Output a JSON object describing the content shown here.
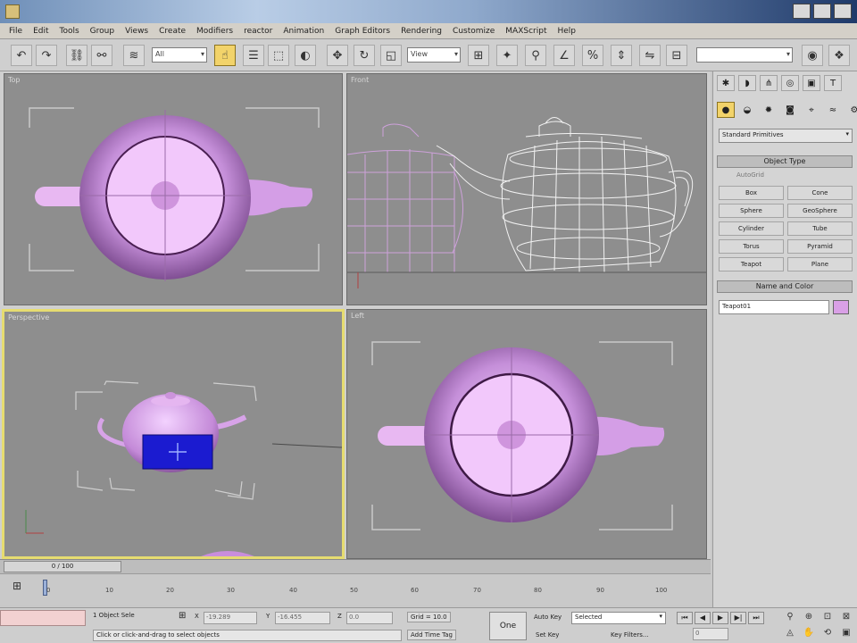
{
  "menu": [
    "File",
    "Edit",
    "Tools",
    "Group",
    "Views",
    "Create",
    "Modifiers",
    "reactor",
    "Animation",
    "Graph Editors",
    "Rendering",
    "Customize",
    "MAXScript",
    "Help"
  ],
  "toolbar": {
    "selection_filter": "All",
    "ref_coord": "View"
  },
  "viewports": {
    "top": "Top",
    "front": "Front",
    "perspective": "Perspective",
    "left": "Left"
  },
  "command_panel": {
    "category": "Standard Primitives",
    "object_type_header": "Object Type",
    "autogrid": "AutoGrid",
    "objects": [
      "Box",
      "Cone",
      "Sphere",
      "GeoSphere",
      "Cylinder",
      "Tube",
      "Torus",
      "Pyramid",
      "Teapot",
      "Plane"
    ],
    "name_color_header": "Name and Color",
    "object_name": "Teapot01",
    "swatch_color": "#d9a0e6"
  },
  "timeline": {
    "slider_label": "0 / 100",
    "ticks": [
      "0",
      "10",
      "20",
      "30",
      "40",
      "50",
      "60",
      "70",
      "80",
      "90",
      "100"
    ]
  },
  "status": {
    "selection": "1 Object Sele",
    "x_value": "-19.289",
    "y_value": "-16.455",
    "z_value": "0.0",
    "grid": "Grid = 10.0",
    "add_time_tag": "Add Time Tag",
    "prompt": "Click or click-and-drag to select objects",
    "auto_key": "Auto Key",
    "set_key": "Set Key",
    "key_mode": "Selected",
    "key_filters": "Key Filters...",
    "frame": "0",
    "one_button": "One"
  }
}
